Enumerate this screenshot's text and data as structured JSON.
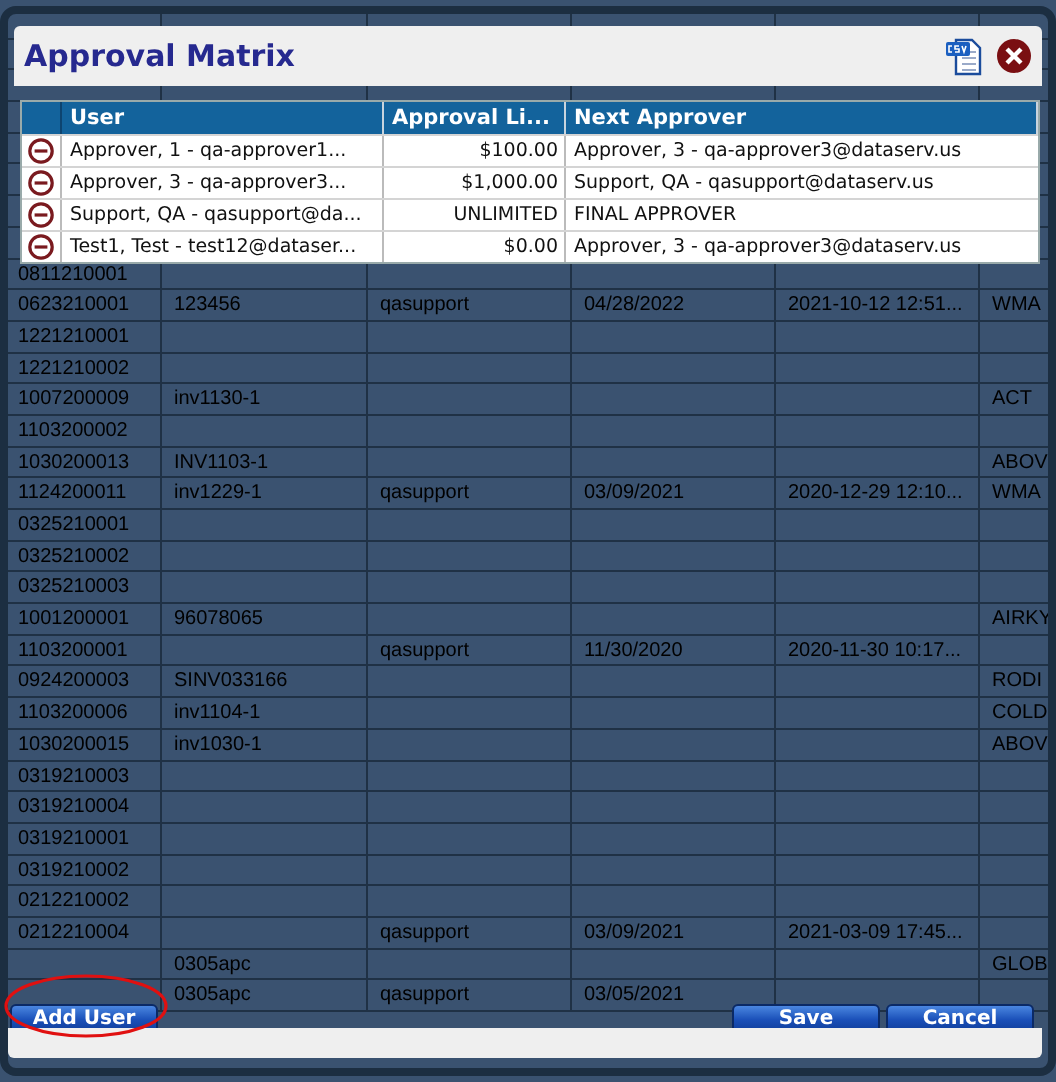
{
  "background_table": {
    "rows": [
      {
        "column_1": "0811210001"
      },
      {
        "column_1": "0623210001",
        "column_2": "123456",
        "column_3": "qasupport",
        "column_4": "04/28/2022",
        "column_5": "2021-10-12 12:51...",
        "column_6": "WMA"
      },
      {
        "column_1": "1221210001"
      },
      {
        "column_1": "1221210002"
      },
      {
        "column_1": "1007200009",
        "column_2": "inv1130-1",
        "column_6": "ACT"
      },
      {
        "column_1": "1103200002"
      },
      {
        "column_1": "1030200013",
        "column_2": "INV1103-1",
        "column_6": "ABOV"
      },
      {
        "column_1": "1124200011",
        "column_2": "inv1229-1",
        "column_3": "qasupport",
        "column_4": "03/09/2021",
        "column_5": "2020-12-29 12:10...",
        "column_6": "WMA"
      },
      {
        "column_1": "0325210001"
      },
      {
        "column_1": "0325210002"
      },
      {
        "column_1": "0325210003"
      },
      {
        "column_1": "1001200001",
        "column_2": "96078065",
        "column_6": "AIRKY"
      },
      {
        "column_1": "1103200001",
        "column_3": "qasupport",
        "column_4": "11/30/2020",
        "column_5": "2020-11-30 10:17..."
      },
      {
        "column_1": "0924200003",
        "column_2": "SINV033166",
        "column_6": "RODI"
      },
      {
        "column_1": "1103200006",
        "column_2": "inv1104-1",
        "column_6": "COLD"
      },
      {
        "column_1": "1030200015",
        "column_2": "inv1030-1",
        "column_6": "ABOV"
      },
      {
        "column_1": "0319210003"
      },
      {
        "column_1": "0319210004"
      },
      {
        "column_1": "0319210001"
      },
      {
        "column_1": "0319210002"
      },
      {
        "column_1": "0212210002"
      },
      {
        "column_1": "0212210004",
        "column_3": "qasupport",
        "column_4": "03/09/2021",
        "column_5": "2021-03-09 17:45..."
      },
      {
        "column_2": "0305apc",
        "column_6": "GLOB"
      },
      {
        "column_2": "0305apc",
        "column_3": "qasupport",
        "column_4": "03/05/2021"
      }
    ]
  },
  "dialog": {
    "title": "Approval Matrix",
    "table": {
      "columns": [
        "User",
        "Approval Li...",
        "Next Approver"
      ],
      "rows": [
        {
          "user": "Approver, 1 - qa-approver1...",
          "limit": "$100.00",
          "next_approver": "Approver, 3 - qa-approver3@dataserv.us"
        },
        {
          "user": "Approver, 3 - qa-approver3...",
          "limit": "$1,000.00",
          "next_approver": "Support, QA - qasupport@dataserv.us"
        },
        {
          "user": "Support, QA - qasupport@da...",
          "limit": "UNLIMITED",
          "next_approver": "FINAL APPROVER"
        },
        {
          "user": "Test1, Test - test12@dataser...",
          "limit": "$0.00",
          "next_approver": "Approver, 3 - qa-approver3@dataserv.us"
        }
      ]
    },
    "buttons": {
      "add": "Add User",
      "save": "Save",
      "cancel": "Cancel"
    },
    "add_user_highlighted": true
  }
}
